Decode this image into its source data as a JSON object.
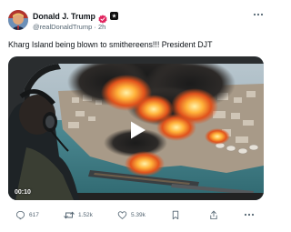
{
  "author": {
    "display_name": "Donald J. Trump",
    "handle": "@realDonaldTrump",
    "separator": "·",
    "time_ago": "2h"
  },
  "post": {
    "text": "Kharg Island being blown to smithereens!!! President DJT"
  },
  "video": {
    "duration": "00:10"
  },
  "actions": {
    "replies": "617",
    "reposts": "1.52k",
    "likes": "5.39k"
  },
  "colors": {
    "verified_badge": "#e0245e",
    "secondary_text": "#536471",
    "primary_text": "#0f1419"
  }
}
